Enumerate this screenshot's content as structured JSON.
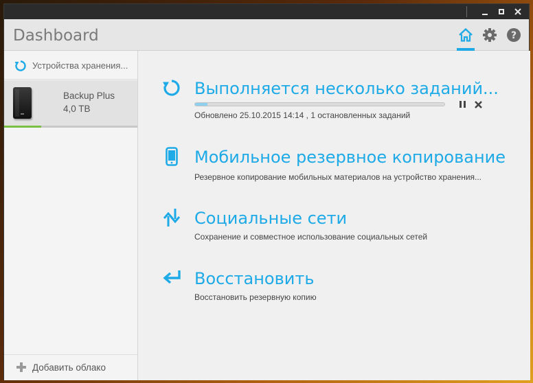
{
  "window": {
    "title": "Dashboard",
    "controls": [
      "minimize-icon",
      "maximize-icon",
      "close-icon"
    ]
  },
  "header": {
    "nav_icons": [
      "home-icon",
      "gear-icon",
      "help-icon"
    ],
    "active": "home-icon",
    "accent_color": "#1eaae7"
  },
  "sidebar": {
    "section_label": "Устройства хранения...",
    "devices": [
      {
        "name": "Backup Plus",
        "capacity": "4,0 TB",
        "usage_fraction": 0.28
      }
    ],
    "add_cloud_label": "Добавить облако"
  },
  "tasks": [
    {
      "icon": "refresh-icon",
      "title": "Выполняется несколько заданий...",
      "subtitle": "Обновлено 25.10.2015 14:14 , 1 остановленных заданий",
      "progress_fraction": 0.05,
      "controls": [
        "pause-icon",
        "cancel-icon"
      ]
    },
    {
      "icon": "mobile-icon",
      "title": "Мобильное резервное копирование",
      "subtitle": "Резервное копирование мобильных материалов на устройство хранения..."
    },
    {
      "icon": "social-sync-icon",
      "title": "Социальные сети",
      "subtitle": "Сохранение и совместное использование социальных сетей"
    },
    {
      "icon": "restore-icon",
      "title": "Восстановить",
      "subtitle": "Восстановить резервную копию"
    }
  ]
}
